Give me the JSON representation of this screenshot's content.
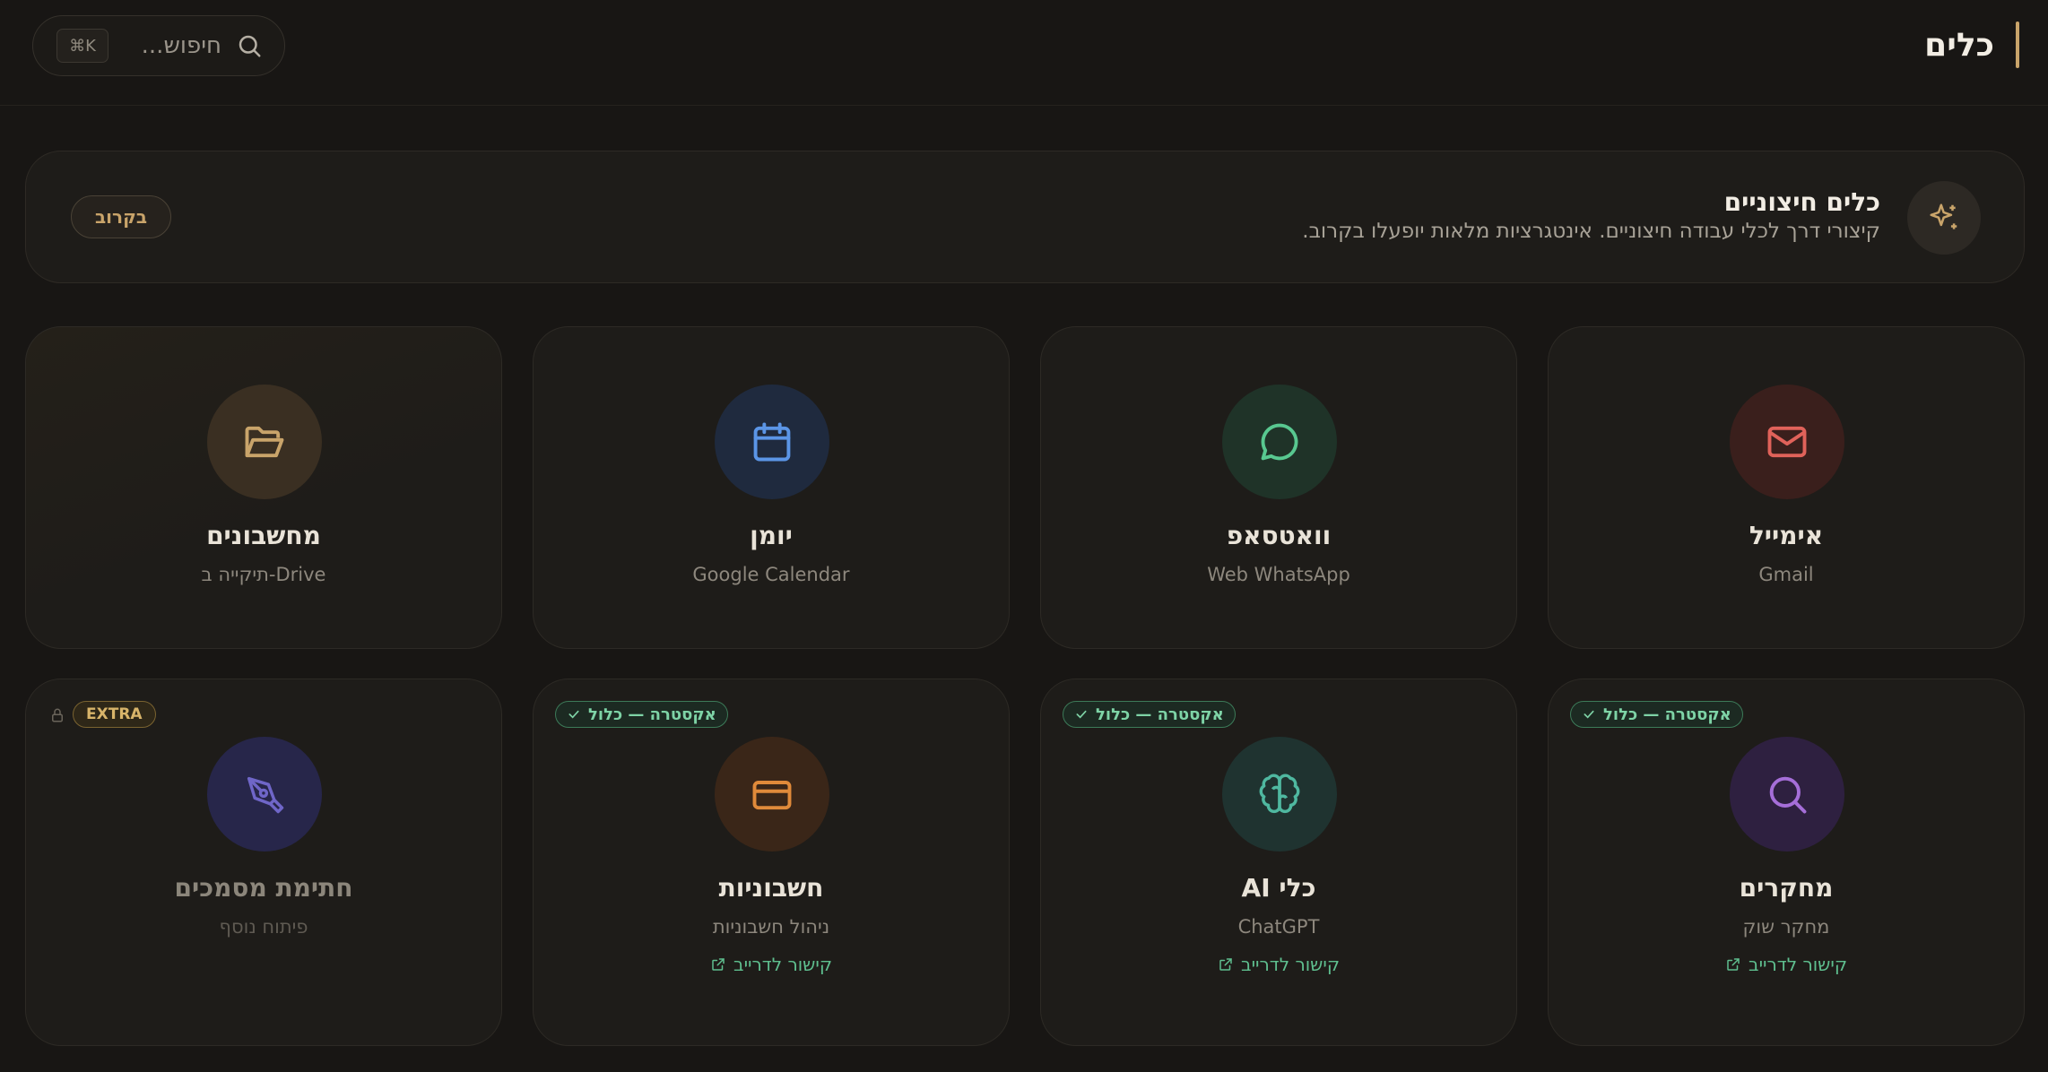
{
  "header": {
    "title": "כלים",
    "search_placeholder": "חיפוש...",
    "shortcut": "⌘K"
  },
  "banner": {
    "title": "כלים חיצוניים",
    "description": "קיצורי דרך לכלי עבודה חיצוניים. אינטגרציות מלאות יופעלו בקרוב.",
    "soon_label": "בקרוב"
  },
  "cards": [
    {
      "title": "אימייל",
      "subtitle": "Gmail",
      "icon": "mail-icon",
      "accent": "#e0625a",
      "tile": "#3a1f1c"
    },
    {
      "title": "וואטסאפ",
      "subtitle": "Web WhatsApp",
      "icon": "message-circle-icon",
      "accent": "#58c890",
      "tile": "#1f3328"
    },
    {
      "title": "יומן",
      "subtitle": "Google Calendar",
      "icon": "calendar-icon",
      "accent": "#5b95e6",
      "tile": "#1f2a3e"
    },
    {
      "title": "מחשבונים",
      "subtitle": "תיקייה ב-Drive",
      "icon": "folder-open-icon",
      "accent": "#c9a46a",
      "tile": "#3a2f22"
    },
    {
      "title": "מחקרים",
      "subtitle": "מחקר שוק",
      "icon": "search-icon",
      "accent": "#a56ed8",
      "tile": "#2e2040",
      "badge": "אקסטרה — כלול",
      "link": "קישור לדרייב"
    },
    {
      "title": "כלי AI",
      "subtitle": "ChatGPT",
      "icon": "brain-icon",
      "accent": "#4fb8a0",
      "tile": "#1f3330",
      "badge": "אקסטרה — כלול",
      "link": "קישור לדרייב"
    },
    {
      "title": "חשבוניות",
      "subtitle": "ניהול חשבוניות",
      "icon": "credit-card-icon",
      "accent": "#e08a3a",
      "tile": "#3a2618",
      "badge": "אקסטרה — כלול",
      "link": "קישור לדרייב"
    },
    {
      "title": "חתימת מסמכים",
      "subtitle": "פיתוח נוסף",
      "icon": "pen-tool-icon",
      "accent": "#6f66c8",
      "tile": "#27264a",
      "extra": "EXTRA",
      "locked": true
    }
  ]
}
